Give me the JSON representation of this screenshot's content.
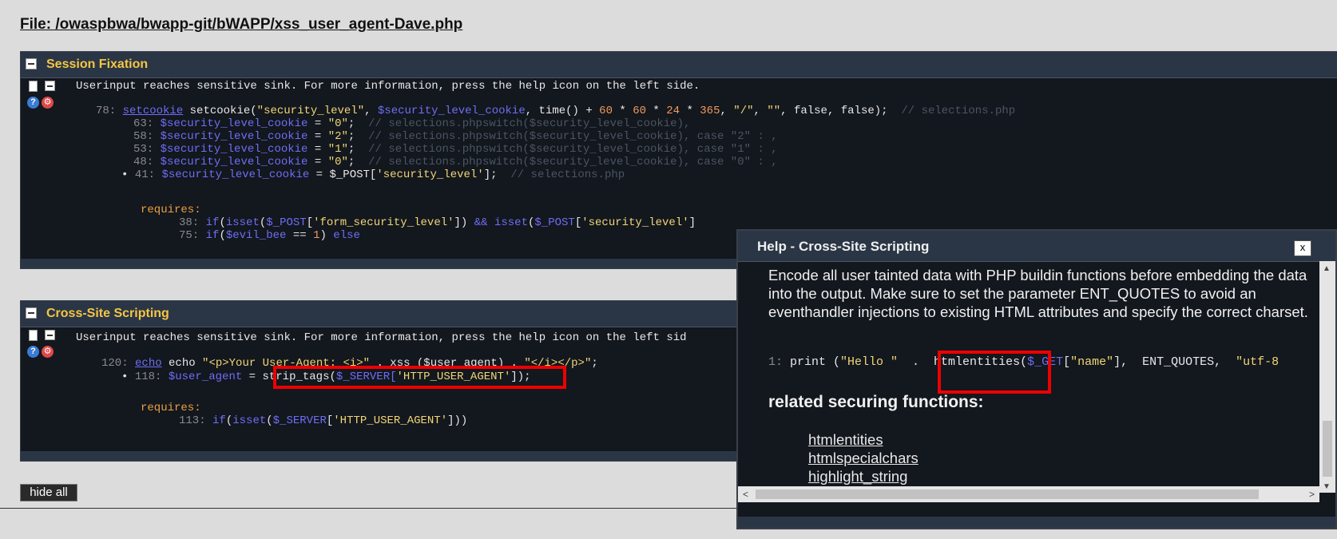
{
  "file_title": "File: /owaspbwa/bwapp-git/bWAPP/xss_user_agent-Dave.php",
  "message": "Userinput reaches sensitive sink. For more information, press the help icon on the left side.",
  "message_cut": "Userinput reaches sensitive sink. For more information, press the help icon on the left sid",
  "session": {
    "title": "Session Fixation",
    "l78": {
      "num": "78:",
      "link": "setcookie",
      "a": " setcookie(",
      "s1": "\"security_level\"",
      "c1": ", ",
      "v1": "$security_level_cookie",
      "c2": ", time() + ",
      "n1": "60",
      "o1": " * ",
      "n2": "60",
      "o2": " * ",
      "n3": "24",
      "o3": " * ",
      "n4": "365",
      "c3": ", ",
      "s2": "\"/\"",
      "c4": ", ",
      "s3": "\"\"",
      "c5": ", false, false);  ",
      "cm": "// selections.php"
    },
    "l63": {
      "num": "63:",
      "v": "$security_level_cookie",
      "eq": " = ",
      "s": "\"0\"",
      "semi": ";  ",
      "cm": "// selections.phpswitch($security_level_cookie),"
    },
    "l58": {
      "num": "58:",
      "v": "$security_level_cookie",
      "eq": " = ",
      "s": "\"2\"",
      "semi": ";  ",
      "cm": "// selections.phpswitch($security_level_cookie), case \"2\" : ,"
    },
    "l53": {
      "num": "53:",
      "v": "$security_level_cookie",
      "eq": " = ",
      "s": "\"1\"",
      "semi": ";  ",
      "cm": "// selections.phpswitch($security_level_cookie), case \"1\" : ,"
    },
    "l48": {
      "num": "48:",
      "v": "$security_level_cookie",
      "eq": " = ",
      "s": "\"0\"",
      "semi": ";  ",
      "cm": "// selections.phpswitch($security_level_cookie), case \"0\" : ,"
    },
    "l41": {
      "bullet": "•",
      "num": "41:",
      "v": "$security_level_cookie",
      "eq": " = ",
      "p": "$_POST[",
      "s": "'security_level'",
      "end": "];  ",
      "cm": "// selections.php"
    },
    "requires": "requires:",
    "r38": {
      "num": "38:",
      "k1": "if",
      "a": "(",
      "k2": "isset",
      "b": "(",
      "v1": "$_POST",
      "c": "[",
      "s1": "'form_security_level'",
      "d": "]) ",
      "op": "&&",
      "e": " ",
      "k3": "isset",
      "f": "(",
      "v2": "$_POST",
      "g": "[",
      "s2": "'security_level'",
      "h": "]"
    },
    "r75": {
      "num": "75:",
      "k1": "if",
      "a": "(",
      "v": "$evil_bee",
      "b": " == ",
      "n": "1",
      "c": ") ",
      "k2": "else"
    }
  },
  "xss": {
    "title": "Cross-Site Scripting",
    "l120": {
      "num": "120:",
      "link": "echo",
      "a": " echo ",
      "s": "\"<p>Your User-Agent: <i>\"",
      "b": " . xss ($user_agent) . ",
      "s2": "\"</i></p>\"",
      "c": ";"
    },
    "l118": {
      "bullet": "•",
      "num": "118:",
      "v": "$user_agent",
      "eq": " = ",
      "f": "strip_tags(",
      "p": "$_SERVER[",
      "s": "'HTTP_USER_AGENT'",
      "end": "]);"
    },
    "requires": "requires:",
    "r113": {
      "num": "113:",
      "k1": "if",
      "a": "(",
      "k2": "isset",
      "b": "(",
      "v": "$_SERVER",
      "c": "[",
      "s": "'HTTP_USER_AGENT'",
      "d": "]))"
    }
  },
  "hide_all_label": "hide all",
  "help": {
    "title": "Help - Cross-Site Scripting",
    "close_label": "x",
    "text": "Encode all user tainted data with PHP buildin functions before embedding the data into the output. Make sure to set the parameter ENT_QUOTES to avoid an eventhandler injections to existing HTML attributes and specify the correct charset.",
    "code": {
      "num": "1:",
      "a": " print (",
      "s1": "\"Hello \"",
      "b": "  .  htmlentities(",
      "v": "$_GET",
      "c": "[",
      "s2": "\"name\"",
      "d": "],  ENT_QUOTES,  ",
      "s3": "\"utf-8"
    },
    "related_heading": "related securing functions:",
    "related": [
      "htmlentities",
      "htmlspecialchars",
      "highlight_string"
    ]
  }
}
